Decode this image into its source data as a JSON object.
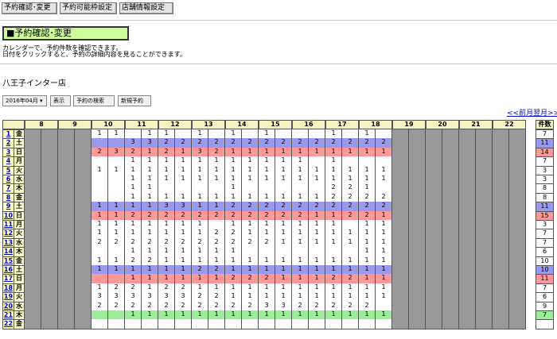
{
  "nav": {
    "confirm_change": "予約確認･変更",
    "availability": "予約可能枠設定",
    "store_info": "店舗情報設定"
  },
  "section": {
    "title": "■予約確認･変更",
    "desc_line1": "カレンダーで、予約件数を確認できます。",
    "desc_line2": "日付をクリックすると、予約の詳細内容を見ることができます。"
  },
  "store": {
    "name": "八王子インター店"
  },
  "controls": {
    "month_select": "2016年04月 ▾",
    "show_button": "表示",
    "search_button": "予約の検索",
    "new_button": "新規予約"
  },
  "pager": {
    "prev": "<<前月",
    "next": "翌月>>"
  },
  "table": {
    "total_header": "件数",
    "hours": [
      "8",
      "9",
      "10",
      "11",
      "12",
      "13",
      "14",
      "15",
      "16",
      "17",
      "18",
      "19",
      "20",
      "21",
      "22"
    ]
  },
  "colors": {
    "closed": "#999999",
    "open": "#ffffff",
    "saturday": "#9999ee",
    "holiday": "#ff9999",
    "highlight": "#99ee99"
  },
  "days": [
    {
      "d": "1",
      "w": "金",
      "bg": "open",
      "total": "7",
      "cells": [
        "",
        "",
        "",
        "",
        "1",
        "1",
        "",
        "1",
        "1",
        "",
        "1",
        "",
        "1",
        "",
        "1",
        "",
        "",
        "",
        "1",
        "",
        "1",
        "",
        "",
        "",
        "",
        "",
        "",
        "",
        "",
        ""
      ]
    },
    {
      "d": "2",
      "w": "土",
      "bg": "saturday",
      "total": "11",
      "cells": [
        "",
        "",
        "",
        "",
        "",
        "",
        "3",
        "3",
        "2",
        "2",
        "2",
        "2",
        "2",
        "2",
        "2",
        "2",
        "2",
        "2",
        "2",
        "2",
        "2",
        "2",
        "2",
        "",
        "2",
        "1",
        "",
        "",
        "",
        ""
      ]
    },
    {
      "d": "3",
      "w": "日",
      "bg": "holiday",
      "total": "14",
      "cells": [
        "",
        "",
        "",
        "",
        "2",
        "3",
        "2",
        "1",
        "2",
        "1",
        "3",
        "2",
        "1",
        "1",
        "1",
        "1",
        "1",
        "1",
        "1",
        "1",
        "1",
        "1",
        "2",
        "1",
        "1",
        "1",
        "",
        "",
        "",
        ""
      ]
    },
    {
      "d": "4",
      "w": "月",
      "bg": "open",
      "total": "7",
      "cells": [
        "",
        "",
        "",
        "",
        "",
        "",
        "1",
        "1",
        "1",
        "1",
        "1",
        "1",
        "1",
        "1",
        "1",
        "1",
        "1",
        "",
        "1",
        "",
        "",
        "",
        "",
        "1",
        "1",
        "",
        "",
        "",
        "",
        ""
      ]
    },
    {
      "d": "5",
      "w": "火",
      "bg": "open",
      "total": "3",
      "cells": [
        "",
        "",
        "",
        "",
        "1",
        "1",
        "1",
        "1",
        "1",
        "1",
        "1",
        "1",
        "1",
        "1",
        "1",
        "1",
        "1",
        "1",
        "1",
        "1",
        "1",
        "1",
        "1",
        "",
        "",
        "",
        "",
        "",
        "",
        ""
      ]
    },
    {
      "d": "6",
      "w": "水",
      "bg": "open",
      "total": "3",
      "cells": [
        "",
        "",
        "",
        "",
        "",
        "",
        "1",
        "1",
        "1",
        "1",
        "1",
        "1",
        "1",
        "1",
        "1",
        "1",
        "1",
        "1",
        "1",
        "1",
        "1",
        "1",
        "1",
        "",
        "1",
        "1",
        "",
        "",
        "",
        ""
      ]
    },
    {
      "d": "7",
      "w": "木",
      "bg": "open",
      "total": "8",
      "cells": [
        "",
        "",
        "",
        "",
        "",
        "",
        "1",
        "1",
        "",
        "",
        "",
        "",
        "1",
        "",
        "",
        "",
        "",
        "",
        "2",
        "2",
        "1",
        "",
        "1",
        "",
        "2",
        "2",
        "",
        "",
        "",
        ""
      ]
    },
    {
      "d": "8",
      "w": "金",
      "bg": "open",
      "total": "8",
      "cells": [
        "",
        "",
        "",
        "",
        "",
        "",
        "1",
        "1",
        "1",
        "1",
        "1",
        "1",
        "1",
        "1",
        "1",
        "1",
        "1",
        "1",
        "2",
        "2",
        "2",
        "2",
        "2",
        "",
        "2",
        "2",
        "",
        "",
        "",
        ""
      ]
    },
    {
      "d": "9",
      "w": "土",
      "bg": "saturday",
      "total": "11",
      "cells": [
        "",
        "",
        "",
        "",
        "1",
        "1",
        "1",
        "1",
        "3",
        "3",
        "1",
        "1",
        "2",
        "2",
        "2",
        "2",
        "2",
        "2",
        "2",
        "2",
        "2",
        "2",
        "2",
        "",
        "1",
        "1",
        "",
        "",
        "",
        ""
      ]
    },
    {
      "d": "10",
      "w": "日",
      "bg": "holiday",
      "total": "15",
      "cells": [
        "",
        "",
        "",
        "",
        "1",
        "1",
        "2",
        "2",
        "2",
        "2",
        "2",
        "2",
        "2",
        "2",
        "2",
        "2",
        "2",
        "1",
        "1",
        "2",
        "2",
        "1",
        "2",
        "",
        "2",
        "1",
        "",
        "",
        "",
        ""
      ]
    },
    {
      "d": "11",
      "w": "月",
      "bg": "open",
      "total": "3",
      "cells": [
        "",
        "",
        "",
        "",
        "1",
        "1",
        "1",
        "1",
        "1",
        "1",
        "1",
        "",
        "1",
        "1",
        "1",
        "1",
        "1",
        "1",
        "1",
        "",
        "1",
        "1",
        "",
        "",
        "",
        "",
        "",
        "",
        "",
        ""
      ]
    },
    {
      "d": "12",
      "w": "火",
      "bg": "open",
      "total": "7",
      "cells": [
        "",
        "",
        "",
        "",
        "1",
        "1",
        "1",
        "1",
        "1",
        "1",
        "1",
        "2",
        "2",
        "1",
        "1",
        "1",
        "1",
        "1",
        "1",
        "1",
        "1",
        "1",
        "1",
        "1",
        "1",
        "",
        "",
        "",
        "",
        ""
      ]
    },
    {
      "d": "13",
      "w": "水",
      "bg": "open",
      "total": "7",
      "cells": [
        "",
        "",
        "",
        "",
        "2",
        "2",
        "2",
        "2",
        "2",
        "2",
        "2",
        "2",
        "2",
        "2",
        "2",
        "1",
        "1",
        "1",
        "1",
        "1",
        "1",
        "1",
        "1",
        "",
        "",
        "",
        "",
        "",
        "",
        ""
      ]
    },
    {
      "d": "14",
      "w": "木",
      "bg": "open",
      "total": "6",
      "cells": [
        "",
        "",
        "",
        "",
        "",
        "",
        "1",
        "1",
        "1",
        "1",
        "1",
        "1",
        "1",
        "",
        "",
        "",
        "",
        "",
        "",
        "",
        "1",
        "1",
        "1",
        "",
        "1",
        "1",
        "",
        "",
        "",
        ""
      ]
    },
    {
      "d": "15",
      "w": "金",
      "bg": "open",
      "total": "10",
      "cells": [
        "",
        "",
        "",
        "",
        "1",
        "1",
        "2",
        "2",
        "1",
        "1",
        "1",
        "1",
        "1",
        "1",
        "1",
        "1",
        "1",
        "1",
        "1",
        "1",
        "1",
        "1",
        "1",
        "",
        "1",
        "1",
        "",
        "",
        "",
        ""
      ]
    },
    {
      "d": "16",
      "w": "土",
      "bg": "saturday",
      "total": "10",
      "cells": [
        "",
        "",
        "",
        "",
        "1",
        "1",
        "1",
        "1",
        "1",
        "1",
        "2",
        "2",
        "1",
        "1",
        "1",
        "1",
        "1",
        "1",
        "1",
        "1",
        "1",
        "1",
        "1",
        "",
        "1",
        "1",
        "",
        "",
        "",
        ""
      ]
    },
    {
      "d": "17",
      "w": "日",
      "bg": "holiday",
      "total": "11",
      "cells": [
        "",
        "",
        "",
        "",
        "",
        "",
        "1",
        "1",
        "1",
        "1",
        "1",
        "1",
        "2",
        "2",
        "2",
        "1",
        "1",
        "1",
        "2",
        "2",
        "1",
        "1",
        "2",
        "",
        "2",
        "2",
        "",
        "",
        "",
        ""
      ]
    },
    {
      "d": "18",
      "w": "月",
      "bg": "open",
      "total": "7",
      "cells": [
        "",
        "",
        "",
        "",
        "1",
        "2",
        "2",
        "1",
        "2",
        "2",
        "1",
        "1",
        "1",
        "1",
        "1",
        "1",
        "1",
        "1",
        "1",
        "1",
        "1",
        "1",
        "1",
        "",
        "1",
        "1",
        "",
        "",
        "",
        ""
      ]
    },
    {
      "d": "19",
      "w": "火",
      "bg": "open",
      "total": "6",
      "cells": [
        "",
        "",
        "",
        "",
        "3",
        "3",
        "3",
        "3",
        "3",
        "3",
        "2",
        "2",
        "1",
        "1",
        "1",
        "1",
        "1",
        "1",
        "1",
        "1",
        "1",
        "1",
        "1",
        "",
        "",
        "",
        "",
        "",
        "",
        ""
      ]
    },
    {
      "d": "20",
      "w": "水",
      "bg": "open",
      "total": "9",
      "cells": [
        "",
        "",
        "",
        "",
        "2",
        "2",
        "2",
        "2",
        "2",
        "2",
        "2",
        "2",
        "2",
        "2",
        "3",
        "3",
        "2",
        "2",
        "2",
        "2",
        "2",
        "",
        "",
        "",
        "",
        "",
        "",
        "",
        "",
        ""
      ]
    },
    {
      "d": "21",
      "w": "木",
      "bg": "highlight",
      "total": "7",
      "cells": [
        "",
        "",
        "",
        "",
        "",
        "",
        "1",
        "1",
        "1",
        "1",
        "1",
        "1",
        "1",
        "1",
        "1",
        "1",
        "1",
        "1",
        "1",
        "1",
        "1",
        "1",
        "1",
        "",
        "1",
        "1",
        "",
        "",
        "",
        ""
      ]
    },
    {
      "d": "22",
      "w": "金",
      "bg": "open",
      "total": "",
      "cells": [
        "",
        "",
        "",
        "",
        "",
        "",
        "",
        "",
        "",
        "",
        "",
        "",
        "",
        "",
        "",
        "",
        "",
        "",
        "",
        "",
        "",
        "",
        "",
        "",
        "",
        "",
        "",
        "",
        "",
        ""
      ]
    }
  ]
}
